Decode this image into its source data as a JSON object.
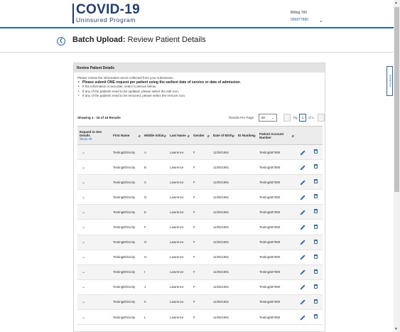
{
  "header": {
    "logo_title": "COVID-19",
    "logo_subtitle": "Uninsured Program",
    "billing_label": "Billing TIN",
    "billing_value": "999877880"
  },
  "titlebar": {
    "title_bold": "Batch Upload:",
    "title_rest": " Review Patient Details"
  },
  "feedback_label": "Feedback",
  "card": {
    "header": "Review Patient Details",
    "intro": "Please review the information we've collected from your submission.",
    "bullets": [
      "Please submit ONE request per patient using the earliest date of service or date of admission.",
      "If the information is accurate, select Continue below.",
      "If any of the patients need to be updated, please select the edit icon.",
      "If any of the patients need to be removed, please select the remove icon."
    ]
  },
  "results": {
    "showing": "Showing 1 - 16 of 16 Results",
    "per_page_label": "Results Per Page",
    "per_page_value": "50",
    "pg_label": "Pg",
    "pg_value": "1",
    "pg_of": "of 1"
  },
  "table": {
    "columns": {
      "expand": "Expand to See Details",
      "show_all": "Show All",
      "first_name": "First Name",
      "middle": "Middle Initial",
      "last_name": "Last Name",
      "gender": "Gender",
      "dob": "Date of Birth",
      "id_number": "ID Number",
      "account": "Patient Account Number"
    },
    "rows": [
      {
        "first": "TestingEthnicity",
        "middle": "A",
        "last": "Lawrence",
        "gender": "F",
        "dob": "11/05/1991",
        "id": "",
        "account": "Testing587890"
      },
      {
        "first": "TestingEthnicity",
        "middle": "B",
        "last": "Lawrence",
        "gender": "F",
        "dob": "11/05/1991",
        "id": "",
        "account": "Testing587890"
      },
      {
        "first": "TestingEthnicity",
        "middle": "C",
        "last": "Lawrence",
        "gender": "F",
        "dob": "11/05/1991",
        "id": "",
        "account": "Testing587890"
      },
      {
        "first": "TestingEthnicity",
        "middle": "D",
        "last": "Lawrence",
        "gender": "F",
        "dob": "11/05/1991",
        "id": "",
        "account": "Testing587890"
      },
      {
        "first": "TestingEthnicity",
        "middle": "E",
        "last": "Lawrence",
        "gender": "F",
        "dob": "11/05/1991",
        "id": "",
        "account": "Testing587890"
      },
      {
        "first": "TestingEthnicity",
        "middle": "F",
        "last": "Lawrence",
        "gender": "F",
        "dob": "11/05/1991",
        "id": "",
        "account": "Testing587890"
      },
      {
        "first": "TestingEthnicity",
        "middle": "G",
        "last": "Lawrence",
        "gender": "F",
        "dob": "11/05/1991",
        "id": "",
        "account": "Testing587890"
      },
      {
        "first": "TestingEthnicity",
        "middle": "H",
        "last": "Lawrence",
        "gender": "F",
        "dob": "11/05/1991",
        "id": "",
        "account": "Testing587890"
      },
      {
        "first": "TestingEthnicity",
        "middle": "I",
        "last": "Lawrence",
        "gender": "F",
        "dob": "11/05/1991",
        "id": "",
        "account": "Testing587890"
      },
      {
        "first": "TestingEthnicity",
        "middle": "J",
        "last": "Lawrence",
        "gender": "F",
        "dob": "11/05/1991",
        "id": "",
        "account": "Testing587890"
      },
      {
        "first": "TestingEthnicity",
        "middle": "K",
        "last": "Lawrence",
        "gender": "F",
        "dob": "11/05/1991",
        "id": "",
        "account": "Testing587890"
      },
      {
        "first": "TestingEthnicity",
        "middle": "L",
        "last": "Lawrence",
        "gender": "F",
        "dob": "11/05/1991",
        "id": "",
        "account": "Testing587890"
      }
    ]
  },
  "colors": {
    "brand_navy": "#1f3f73",
    "accent_blue": "#2c6ab0",
    "header_rule": "#2c6a9e"
  }
}
